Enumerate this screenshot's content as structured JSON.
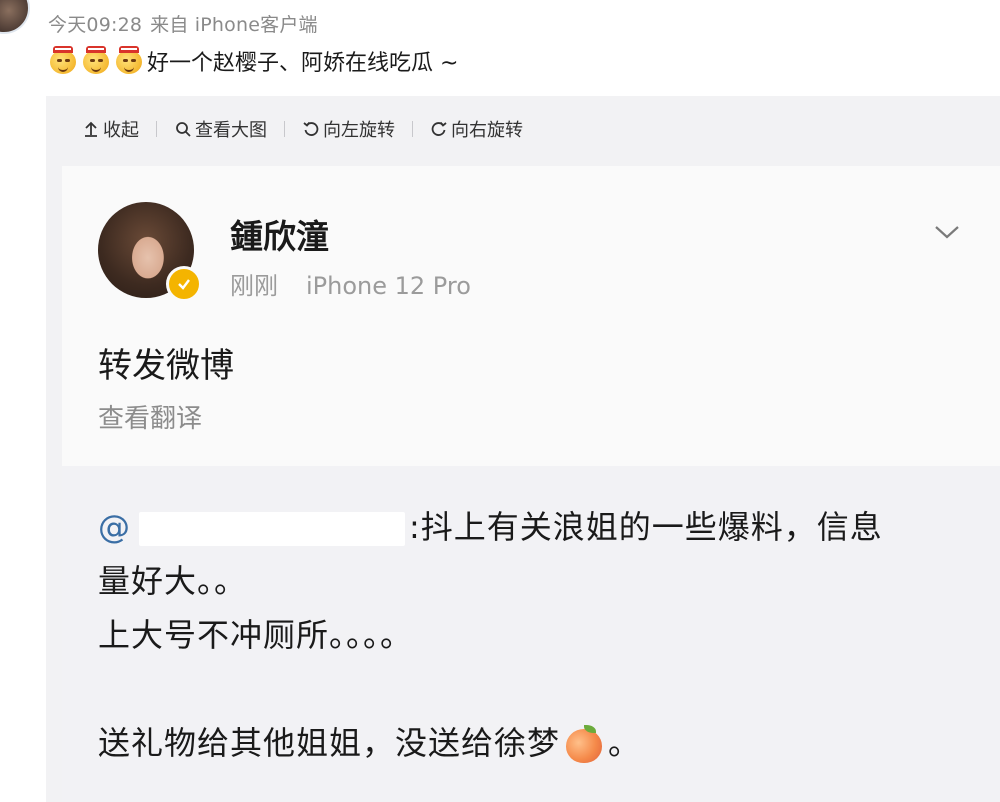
{
  "post": {
    "time": "今天09:28",
    "source": "来自 iPhone客户端",
    "emoji_count": 3,
    "text": "好一个赵樱子、阿娇在线吃瓜 ~"
  },
  "toolbar": {
    "collapse": "收起",
    "view_large": "查看大图",
    "rotate_left": "向左旋转",
    "rotate_right": "向右旋转"
  },
  "screenshot": {
    "name": "鍾欣潼",
    "time": "刚刚",
    "device": "iPhone 12 Pro",
    "title": "转发微博",
    "translate": "查看翻译",
    "at_symbol": "@",
    "line1": ":抖上有关浪姐的一些爆料，信息",
    "line2": "量好大。。",
    "line3": "上大号不冲厕所。。。。",
    "line4a": "送礼物给其他姐姐，没送给徐梦",
    "line4b": "。"
  },
  "colors": {
    "mention_blue": "#3a6ea5",
    "verified_gold": "#f4b400"
  },
  "icons": [
    "collapse-up-icon",
    "magnifier-icon",
    "rotate-left-icon",
    "rotate-right-icon",
    "chevron-down-icon",
    "verified-badge-icon",
    "peach-emoji-icon",
    "hat-face-emoji-icon"
  ]
}
